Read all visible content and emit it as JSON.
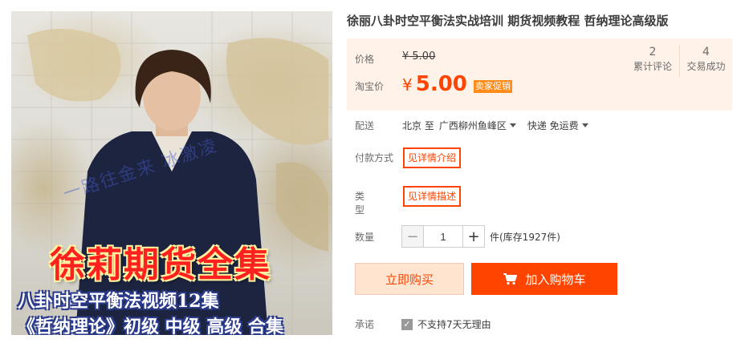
{
  "product": {
    "title": "徐丽八卦时空平衡法实战培训 期货视频教程 哲纳理论高级版",
    "image": {
      "watermark": "一路往金来 冰激凌",
      "headline": "徐莉期货全集",
      "line1": "八卦时空平衡法视频12集",
      "line2": "《哲纳理论》初级 中级 高级 合集"
    }
  },
  "price": {
    "label": "价格",
    "original": "¥ 5.00",
    "taobao_label": "淘宝价",
    "currency": "¥",
    "current": "5.00",
    "promo_badge": "卖家促销"
  },
  "stats": [
    {
      "value": "2",
      "label": "累计评论"
    },
    {
      "value": "4",
      "label": "交易成功"
    }
  ],
  "shipping": {
    "label": "配送",
    "from": "北京 至",
    "destination": "广西柳州鱼峰区",
    "method": "快递 免运费"
  },
  "payment": {
    "label": "付款方式",
    "option": "见详情介绍"
  },
  "type": {
    "label": "类型",
    "option": "见详情描述"
  },
  "quantity": {
    "label": "数量",
    "minus": "−",
    "value": "1",
    "plus": "+",
    "stock": "件(库存1927件)"
  },
  "actions": {
    "buy_now": "立即购买",
    "add_to_cart": "加入购物车"
  },
  "service": {
    "label": "承诺",
    "text": "不支持7天无理由"
  },
  "colors": {
    "accent": "#ff4400",
    "price_bg": "#fff2e8",
    "badge": "#ff8c1a"
  },
  "icons": [
    "cart-icon",
    "chevron-down-icon",
    "check-icon"
  ]
}
